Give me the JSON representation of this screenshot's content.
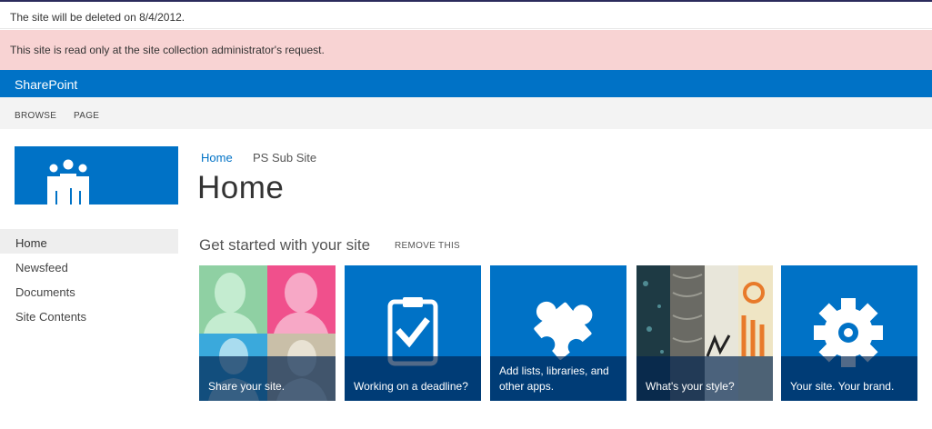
{
  "notice": {
    "text": "The site will be deleted on 8/4/2012."
  },
  "status_bar": {
    "text": "This site is read only at the site collection administrator's request.",
    "color": "#f8d3d3"
  },
  "suite_bar": {
    "brand": "SharePoint",
    "color": "#0072c6"
  },
  "ribbon": {
    "tabs": [
      "BROWSE",
      "PAGE"
    ]
  },
  "site_logo": {
    "icon": "people-icon",
    "color": "#0072c6"
  },
  "quick_launch": {
    "items": [
      {
        "label": "Home",
        "selected": true
      },
      {
        "label": "Newsfeed",
        "selected": false
      },
      {
        "label": "Documents",
        "selected": false
      },
      {
        "label": "Site Contents",
        "selected": false
      }
    ]
  },
  "breadcrumb": {
    "home": "Home",
    "current": "PS Sub Site"
  },
  "page": {
    "title": "Home"
  },
  "get_started": {
    "title": "Get started with your site",
    "remove_label": "REMOVE THIS",
    "tiles": [
      {
        "caption": "Share your site.",
        "icon": "people-silhouettes-image"
      },
      {
        "caption": "Working on a deadline?",
        "icon": "clipboard-check-icon"
      },
      {
        "caption": "Add lists, libraries, and other apps.",
        "icon": "puzzle-piece-icon"
      },
      {
        "caption": "What's your style?",
        "icon": "style-collage-image"
      },
      {
        "caption": "Your site. Your brand.",
        "icon": "gear-icon"
      }
    ]
  }
}
